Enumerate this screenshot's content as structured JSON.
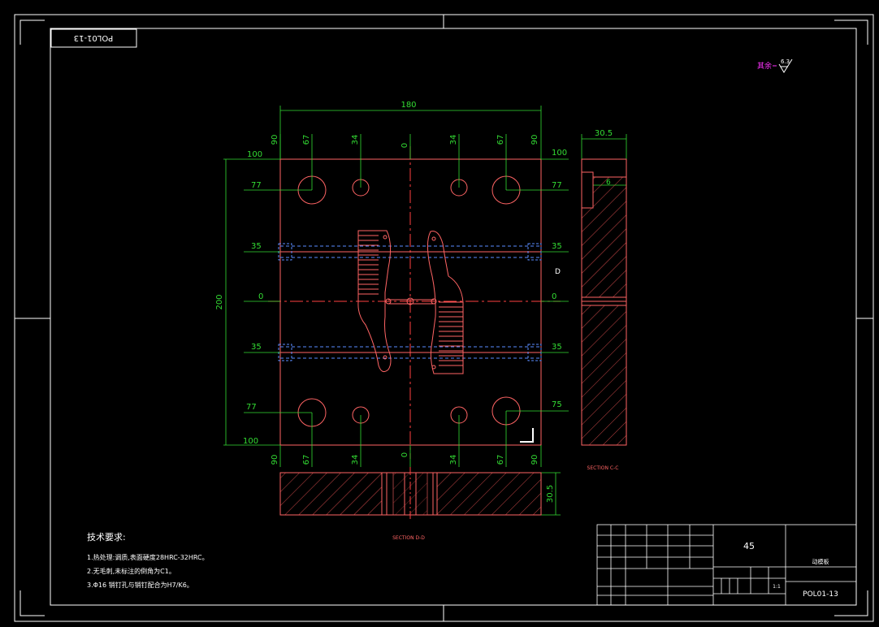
{
  "drawing": {
    "code_rotated": "POL01-13",
    "roughness": "6.3",
    "roughness_prefix": "其余",
    "section_cc": "SECTION C-C",
    "section_dd": "SECTION D-D",
    "section_marker": "D",
    "dim_width": "180",
    "dim_height": "200",
    "dim_side_thickness": "30.5",
    "dim_bottom_thickness": "30.5",
    "dim_side_detail": "6"
  },
  "dims": {
    "top": [
      "90",
      "67",
      "34",
      "0",
      "34",
      "67",
      "90"
    ],
    "bottom": [
      "90",
      "67",
      "34",
      "0",
      "34",
      "67",
      "90"
    ],
    "left": [
      "100",
      "77",
      "35",
      "0",
      "35",
      "77",
      "100"
    ],
    "right": [
      "100",
      "77",
      "35",
      "0",
      "35",
      "75"
    ]
  },
  "notes": {
    "title": "技术要求:",
    "items": [
      "1.热处理:调质,表面硬度28HRC-32HRC。",
      "2.无毛刺,未标注的倒角为C1。",
      "3.Φ16 销钉孔与销钉配合为H7/K6。"
    ]
  },
  "title_block": {
    "material": "45",
    "part_name": "动模板",
    "drawing_no": "POL01-13",
    "scale": "1:1"
  }
}
